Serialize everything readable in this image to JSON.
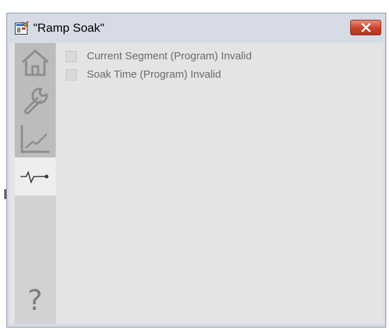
{
  "window": {
    "title": "\"Ramp Soak\"",
    "close_icon": "close-x-icon",
    "app_icon": "faceplate-app-icon"
  },
  "nav": {
    "items": [
      {
        "id": "home",
        "icon": "home-icon",
        "state": "inactive"
      },
      {
        "id": "maintenance",
        "icon": "wrench-icon",
        "state": "inactive"
      },
      {
        "id": "trends",
        "icon": "trend-chart-icon",
        "state": "inactive"
      },
      {
        "id": "diagnostics",
        "icon": "pulse-icon",
        "state": "active"
      }
    ],
    "help_label": "?"
  },
  "alarms": [
    {
      "label": "Current Segment (Program) Invalid",
      "active": false
    },
    {
      "label": "Soak Time (Program) Invalid",
      "active": false
    }
  ],
  "colors": {
    "titlebar": "#d6dbe6",
    "close_button": "#c8432b",
    "content_bg": "#e4e4e4",
    "nav_bg": "#d2d2d2",
    "nav_inactive": "#bcbcbc",
    "nav_active": "#eeeeee",
    "alarm_text": "#6a6a6a"
  }
}
